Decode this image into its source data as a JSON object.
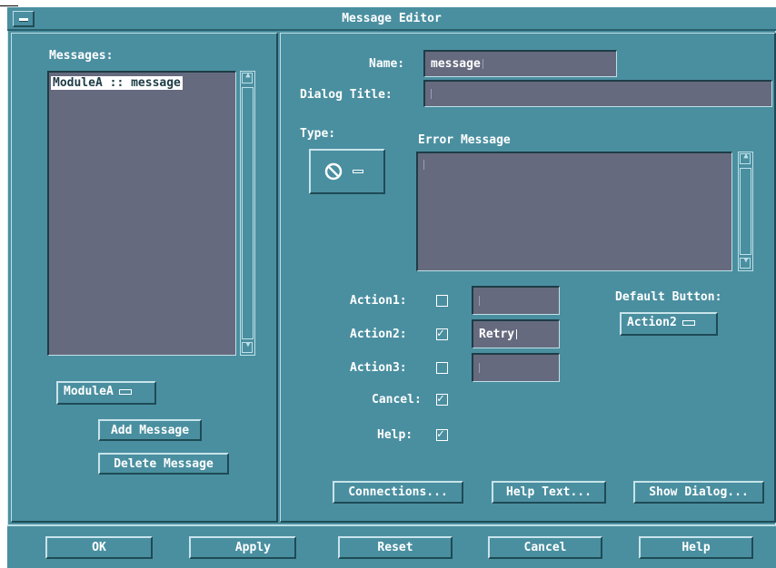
{
  "window": {
    "title": "Message Editor"
  },
  "messages": {
    "label": "Messages:",
    "items": [
      "ModuleA :: message"
    ],
    "module_option": "ModuleA",
    "add_label": "Add Message",
    "delete_label": "Delete Message"
  },
  "form": {
    "name_label": "Name:",
    "name_value": "message",
    "dialog_title_label": "Dialog Title:",
    "dialog_title_value": "",
    "type_label": "Type:",
    "type_icon": "no-entry-icon",
    "error_label": "Error Message",
    "error_value": ""
  },
  "actions": {
    "items": [
      {
        "label": "Action1:",
        "checked": false,
        "value": ""
      },
      {
        "label": "Action2:",
        "checked": true,
        "value": "Retry"
      },
      {
        "label": "Action3:",
        "checked": false,
        "value": ""
      }
    ],
    "cancel_label": "Cancel:",
    "cancel_checked": true,
    "help_label": "Help:",
    "help_checked": true,
    "default_button_label": "Default Button:",
    "default_button_value": "Action2"
  },
  "lower_buttons": {
    "connections": "Connections...",
    "help_text": "Help Text...",
    "show_dialog": "Show Dialog..."
  },
  "footer": {
    "ok": "OK",
    "apply": "Apply",
    "reset": "Reset",
    "cancel": "Cancel",
    "help": "Help"
  },
  "colors": {
    "panel": "#4a8fa0",
    "field": "#666a7e",
    "highlight": "#c8e4ea",
    "shadow": "#1e4a55",
    "text": "#ffffff"
  }
}
